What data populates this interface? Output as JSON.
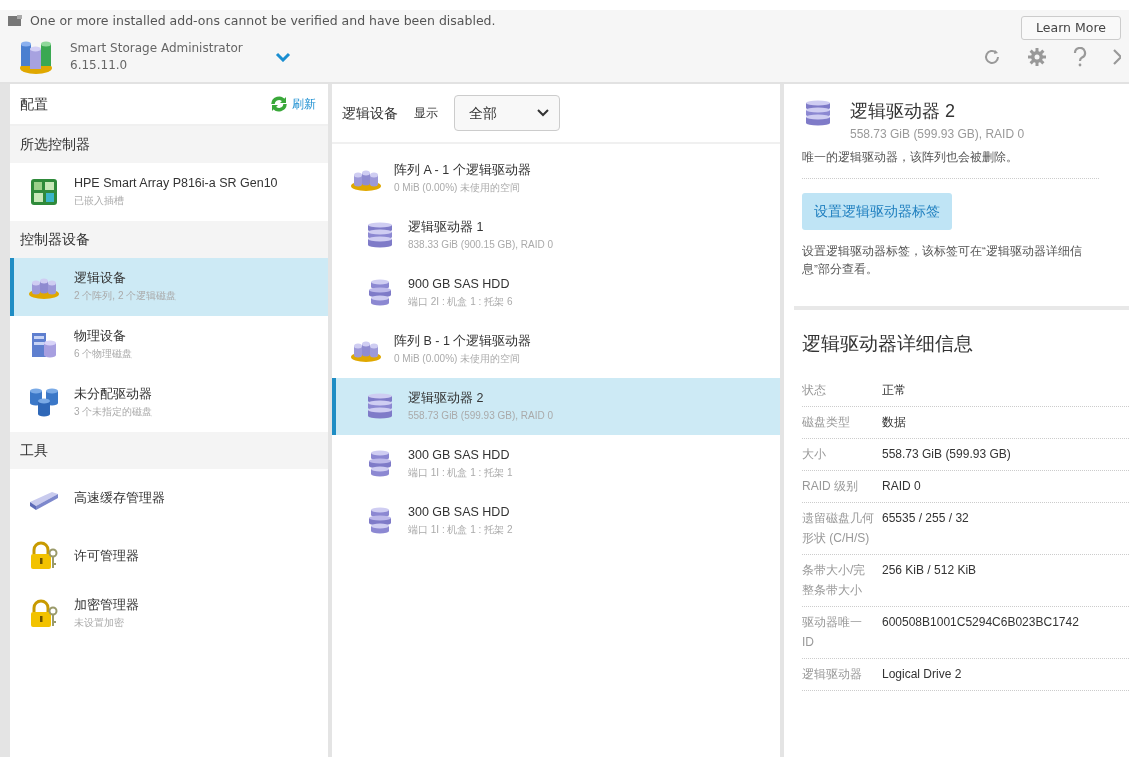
{
  "notice": {
    "text": "One or more installed add-ons cannot be verified and have been disabled.",
    "button": "Learn More"
  },
  "app": {
    "name": "Smart Storage Administrator",
    "version": "6.15.11.0"
  },
  "config_panel": {
    "title": "配置",
    "refresh": "刷新",
    "sections": [
      {
        "heading": "所选控制器",
        "items": [
          {
            "kind": "controller",
            "title": "HPE Smart Array P816i-a SR Gen10",
            "subtitle": "已嵌入插槽",
            "selected": false
          }
        ]
      },
      {
        "heading": "控制器设备",
        "items": [
          {
            "kind": "array",
            "title": "逻辑设备",
            "subtitle": "2 个阵列, 2 个逻辑磁盘",
            "selected": true
          },
          {
            "kind": "physical",
            "title": "物理设备",
            "subtitle": "6 个物理磁盘",
            "selected": false
          },
          {
            "kind": "unassigned",
            "title": "未分配驱动器",
            "subtitle": "3 个未指定的磁盘",
            "selected": false
          }
        ]
      },
      {
        "heading": "工具",
        "items": [
          {
            "kind": "cache",
            "title": "高速缓存管理器",
            "selected": false
          },
          {
            "kind": "lock",
            "title": "许可管理器",
            "selected": false
          },
          {
            "kind": "lock",
            "title": "加密管理器",
            "subtitle": "未设置加密",
            "selected": false
          }
        ]
      }
    ]
  },
  "devices_panel": {
    "title": "逻辑设备",
    "filter_label": "显示",
    "filter_value": "全部",
    "items": [
      {
        "kind": "array",
        "title": "阵列 A - 1 个逻辑驱动器",
        "subtitle": "0 MiB (0.00%) 未使用的空间",
        "selected": false,
        "children": [
          {
            "kind": "logical",
            "title": "逻辑驱动器 1",
            "subtitle": "838.33 GiB (900.15 GB), RAID 0",
            "selected": false
          },
          {
            "kind": "disk",
            "title": "900 GB SAS HDD",
            "subtitle": "端口 2I : 机盒 1 : 托架 6",
            "selected": false
          }
        ]
      },
      {
        "kind": "array",
        "title": "阵列 B - 1 个逻辑驱动器",
        "subtitle": "0 MiB (0.00%) 未使用的空间",
        "selected": false,
        "children": [
          {
            "kind": "logical",
            "title": "逻辑驱动器 2",
            "subtitle": "558.73 GiB (599.93 GB), RAID 0",
            "selected": true
          },
          {
            "kind": "disk",
            "title": "300 GB SAS HDD",
            "subtitle": "端口 1I : 机盒 1 : 托架 1",
            "selected": false
          },
          {
            "kind": "disk",
            "title": "300 GB SAS HDD",
            "subtitle": "端口 1I : 机盒 1 : 托架 2",
            "selected": false
          }
        ]
      }
    ]
  },
  "detail": {
    "title": "逻辑驱动器 2",
    "subtitle": "558.73 GiB (599.93 GB), RAID 0",
    "note": "唯一的逻辑驱动器，该阵列也会被删除。",
    "action": "设置逻辑驱动器标签",
    "action_note": "设置逻辑驱动器标签，该标签可在“逻辑驱动器详细信息”部分查看。",
    "details_title": "逻辑驱动器详细信息",
    "fields": [
      {
        "label": "状态",
        "value": "正常"
      },
      {
        "label": "磁盘类型",
        "value": "数据"
      },
      {
        "label": "大小",
        "value": "558.73 GiB (599.93 GB)"
      },
      {
        "label": "RAID 级别",
        "value": "RAID 0"
      },
      {
        "label": "遗留磁盘几何形状 (C/H/S)",
        "value": "65535 / 255 / 32"
      },
      {
        "label": "条带大小/完整条带大小",
        "value": "256 KiB / 512 KiB"
      },
      {
        "label": "驱动器唯一 ID",
        "value": "600508B1001C5294C6B023BC1742"
      },
      {
        "label": "逻辑驱动器",
        "value": "Logical Drive 2"
      }
    ]
  }
}
